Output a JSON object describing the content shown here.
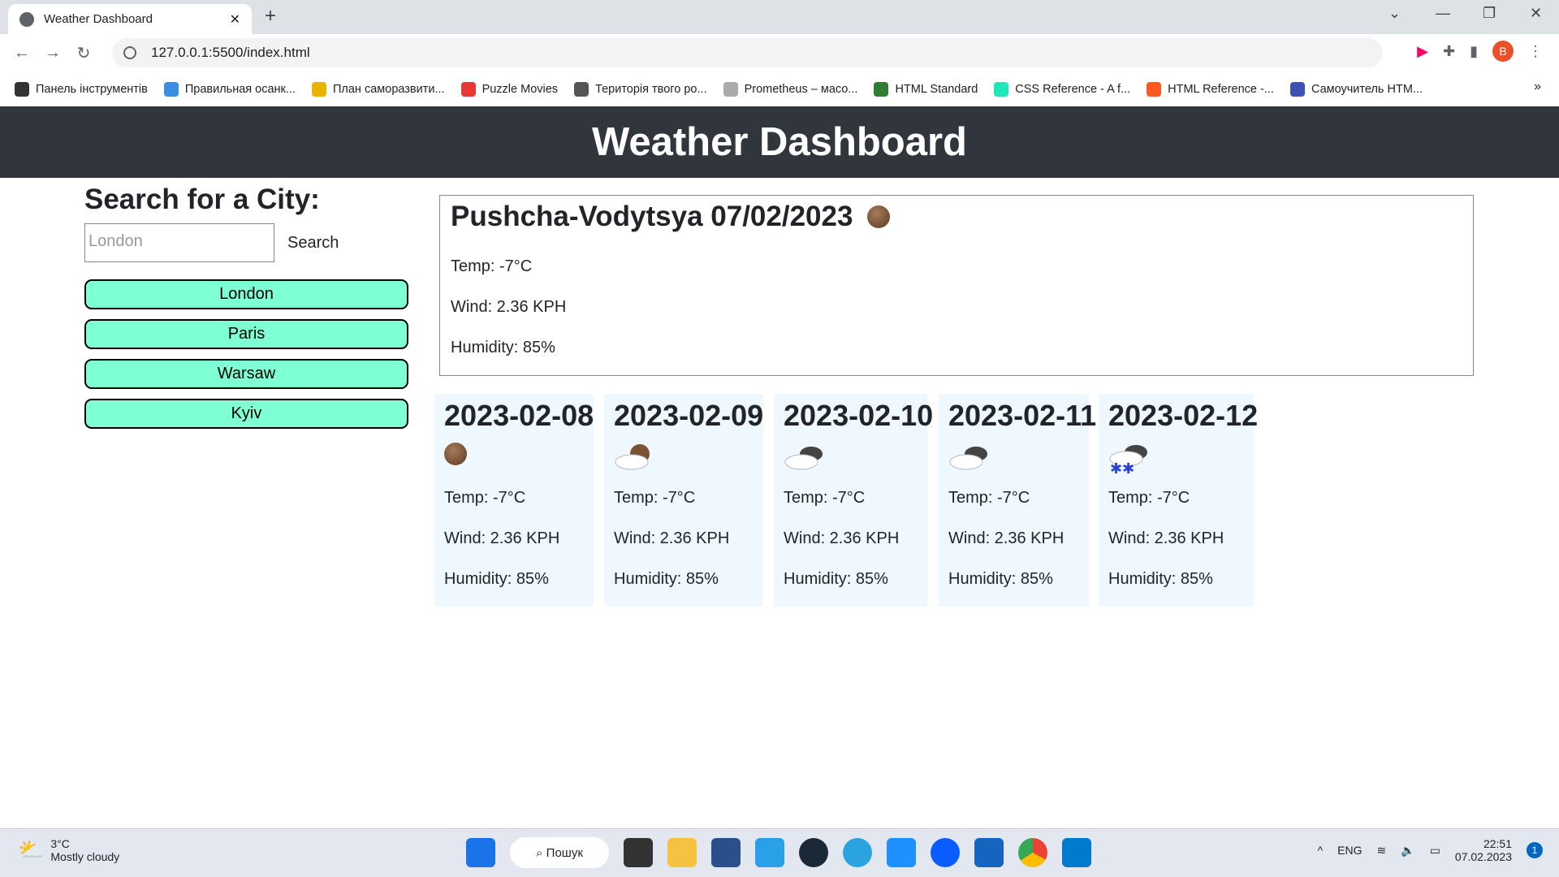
{
  "browser": {
    "tab_title": "Weather Dashboard",
    "url": "127.0.0.1:5500/index.html",
    "profile": "B",
    "bookmarks": [
      "Панель інструментів",
      "Правильная осанк...",
      "План саморазвити...",
      "Puzzle Movies",
      "Територія твого ро...",
      "Prometheus – масо...",
      "HTML Standard",
      "CSS Reference - A f...",
      "HTML Reference -...",
      "Самоучитель HTM..."
    ],
    "bookmark_colors": [
      "#333",
      "#3b8de0",
      "#e8b400",
      "#e53935",
      "#555",
      "#aaa",
      "#2e7d32",
      "#1de9b6",
      "#ff5722",
      "#3f51b5"
    ]
  },
  "header": {
    "title": "Weather Dashboard"
  },
  "search": {
    "title": "Search for a City:",
    "placeholder": "London",
    "button": "Search",
    "history": [
      "London",
      "Paris",
      "Warsaw",
      "Kyiv"
    ]
  },
  "current": {
    "title": "Pushcha-Vodytsya 07/02/2023",
    "icon": "clear-night-icon",
    "temp": "Temp: -7°C",
    "wind": "Wind: 2.36 KPH",
    "humidity": "Humidity: 85%"
  },
  "forecast": [
    {
      "date": "2023-02-08",
      "icon": "clear-night-icon",
      "temp": "Temp: -7°C",
      "wind": "Wind: 2.36 KPH",
      "humidity": "Humidity: 85%"
    },
    {
      "date": "2023-02-09",
      "icon": "partly-cloudy-night-icon",
      "temp": "Temp: -7°C",
      "wind": "Wind: 2.36 KPH",
      "humidity": "Humidity: 85%"
    },
    {
      "date": "2023-02-10",
      "icon": "cloudy-icon",
      "temp": "Temp: -7°C",
      "wind": "Wind: 2.36 KPH",
      "humidity": "Humidity: 85%"
    },
    {
      "date": "2023-02-11",
      "icon": "cloudy-icon",
      "temp": "Temp: -7°C",
      "wind": "Wind: 2.36 KPH",
      "humidity": "Humidity: 85%"
    },
    {
      "date": "2023-02-12",
      "icon": "snow-icon",
      "temp": "Temp: -7°C",
      "wind": "Wind: 2.36 KPH",
      "humidity": "Humidity: 85%"
    }
  ],
  "taskbar": {
    "weather_temp": "3°C",
    "weather_desc": "Mostly cloudy",
    "search": "Пошук",
    "lang": "ENG",
    "time": "22:51",
    "date": "07.02.2023",
    "notifications": "1"
  }
}
